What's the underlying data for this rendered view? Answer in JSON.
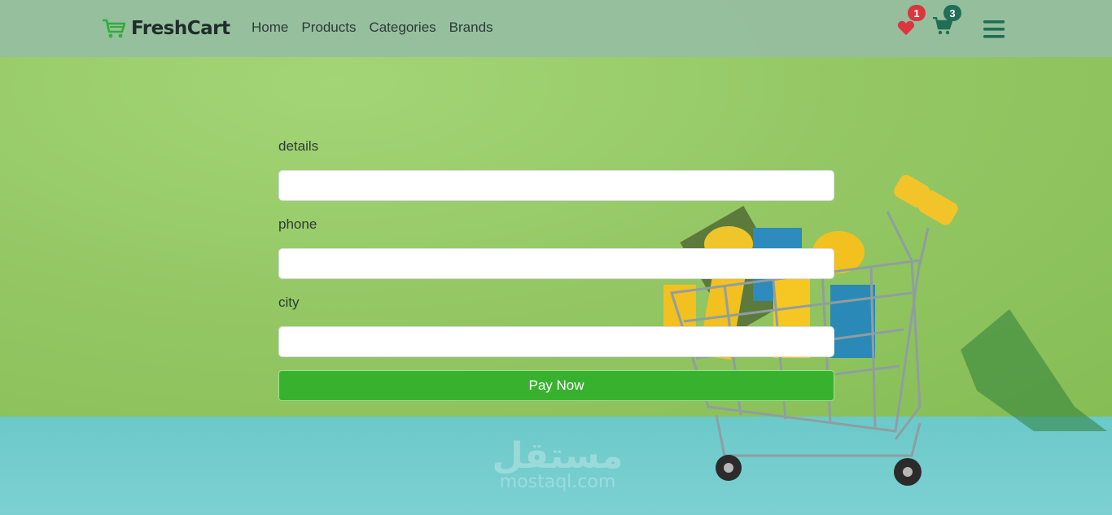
{
  "brand": {
    "name": "FreshCart",
    "icon": "shopping-cart-icon",
    "color": "#2fae3a"
  },
  "nav": {
    "links": [
      "Home",
      "Products",
      "Categories",
      "Brands"
    ]
  },
  "header_icons": {
    "wishlist": {
      "icon": "heart-icon",
      "count": "1",
      "color": "#d9363e"
    },
    "cart": {
      "icon": "cart-icon",
      "count": "3",
      "color": "#1f6e55"
    },
    "menu": {
      "icon": "hamburger-menu-icon"
    }
  },
  "form": {
    "fields": [
      {
        "label": "details",
        "value": "",
        "placeholder": ""
      },
      {
        "label": "phone",
        "value": "",
        "placeholder": ""
      },
      {
        "label": "city",
        "value": "",
        "placeholder": ""
      }
    ],
    "submit_label": "Pay Now",
    "submit_color": "#38b22e"
  },
  "watermark": {
    "arabic": "مستقل",
    "latin": "mostaql.com"
  }
}
